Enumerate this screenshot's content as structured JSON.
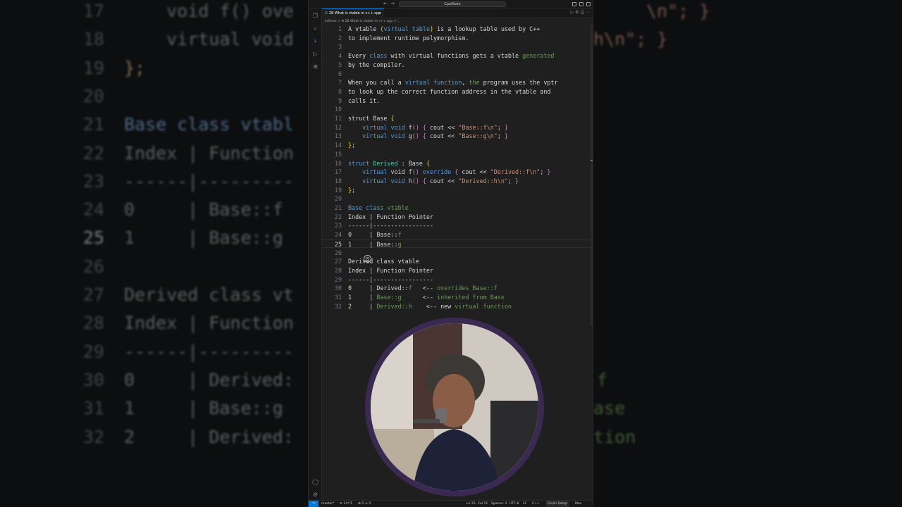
{
  "titlebar": {
    "search": "CppNuts",
    "back": "←",
    "forward": "→"
  },
  "tab": {
    "label": "28 What is vtable in c++.cpp",
    "close": "×"
  },
  "breadcrumb": "InShort  >  ⊕ 28 What is vtable in c++.cpp  >  ...",
  "editor_lines": [
    {
      "n": "1",
      "segs": [
        [
          "A vtable ",
          ""
        ],
        [
          "(",
          "yl"
        ],
        [
          "virtual table",
          "k"
        ],
        [
          ")",
          "yl"
        ],
        [
          " is a lookup table used by C++",
          ""
        ]
      ]
    },
    {
      "n": "2",
      "segs": [
        [
          "to implement runtime polymorphism.",
          ""
        ]
      ]
    },
    {
      "n": "3",
      "segs": []
    },
    {
      "n": "4",
      "segs": [
        [
          "Every ",
          ""
        ],
        [
          "class",
          "k"
        ],
        [
          " with virtual functions gets a vtable ",
          ""
        ],
        [
          "generated",
          "gr"
        ]
      ]
    },
    {
      "n": "5",
      "segs": [
        [
          "by the compiler.",
          ""
        ]
      ]
    },
    {
      "n": "6",
      "segs": []
    },
    {
      "n": "7",
      "segs": [
        [
          "When you call a ",
          ""
        ],
        [
          "virtual",
          "k"
        ],
        [
          " ",
          ""
        ],
        [
          "function",
          "k"
        ],
        [
          ", ",
          ""
        ],
        [
          "the",
          "gr"
        ],
        [
          " program uses the vptr",
          ""
        ]
      ]
    },
    {
      "n": "8",
      "segs": [
        [
          "to look up the correct function address in the vtable and",
          ""
        ]
      ]
    },
    {
      "n": "9",
      "segs": [
        [
          "calls it.",
          ""
        ]
      ]
    },
    {
      "n": "10",
      "segs": []
    },
    {
      "n": "11",
      "segs": [
        [
          "struct Base ",
          ""
        ],
        [
          "{",
          "yl"
        ]
      ]
    },
    {
      "n": "12",
      "segs": [
        [
          "    ",
          ""
        ],
        [
          "virtual void",
          "k"
        ],
        [
          " f",
          ""
        ],
        [
          "()",
          "pu"
        ],
        [
          " ",
          ""
        ],
        [
          "{",
          "pu"
        ],
        [
          " cout << ",
          ""
        ],
        [
          "\"Base::f\\n\"",
          "s"
        ],
        [
          "; ",
          ""
        ],
        [
          "}",
          "pu"
        ]
      ]
    },
    {
      "n": "13",
      "segs": [
        [
          "    ",
          ""
        ],
        [
          "virtual void",
          "k"
        ],
        [
          " g",
          ""
        ],
        [
          "()",
          "pu"
        ],
        [
          " ",
          ""
        ],
        [
          "{",
          "pu"
        ],
        [
          " cout << ",
          ""
        ],
        [
          "\"Base::g\\n\"",
          "s"
        ],
        [
          "; ",
          ""
        ],
        [
          "}",
          "pu"
        ]
      ]
    },
    {
      "n": "14",
      "segs": [
        [
          "}",
          "yl"
        ],
        [
          ";",
          ""
        ]
      ]
    },
    {
      "n": "15",
      "segs": []
    },
    {
      "n": "16",
      "segs": [
        [
          "struct ",
          "k"
        ],
        [
          "Derived",
          "ty"
        ],
        [
          " : Base ",
          ""
        ],
        [
          "{",
          "yl"
        ]
      ]
    },
    {
      "n": "17",
      "segs": [
        [
          "    ",
          ""
        ],
        [
          "virtual",
          "k"
        ],
        [
          " void f",
          ""
        ],
        [
          "()",
          "pu"
        ],
        [
          " override ",
          "k"
        ],
        [
          "{",
          "pu"
        ],
        [
          " cout << ",
          ""
        ],
        [
          "\"Derived::f\\n\"",
          "s"
        ],
        [
          "; ",
          ""
        ],
        [
          "}",
          "pu"
        ]
      ]
    },
    {
      "n": "18",
      "segs": [
        [
          "    ",
          ""
        ],
        [
          "virtual void",
          "k"
        ],
        [
          " h",
          ""
        ],
        [
          "()",
          "pu"
        ],
        [
          " ",
          ""
        ],
        [
          "{",
          "pu"
        ],
        [
          " cout << ",
          ""
        ],
        [
          "\"Derived::h\\n\"",
          "s"
        ],
        [
          "; ",
          ""
        ],
        [
          "}",
          "pu"
        ]
      ]
    },
    {
      "n": "19",
      "segs": [
        [
          "}",
          "yl"
        ],
        [
          ";",
          ""
        ]
      ]
    },
    {
      "n": "20",
      "segs": []
    },
    {
      "n": "21",
      "segs": [
        [
          "Base ",
          "k"
        ],
        [
          "class",
          "k"
        ],
        [
          " vtable",
          "gr"
        ]
      ]
    },
    {
      "n": "22",
      "segs": [
        [
          "Index | Function Pointer",
          ""
        ]
      ]
    },
    {
      "n": "23",
      "segs": [
        [
          "------|-----------------",
          ""
        ]
      ]
    },
    {
      "n": "24",
      "segs": [
        [
          "0     | Base::",
          ""
        ],
        [
          "f",
          "gr"
        ]
      ]
    },
    {
      "n": "25",
      "segs": [
        [
          "1     | Base::",
          ""
        ],
        [
          "g",
          "gr"
        ]
      ],
      "current": true
    },
    {
      "n": "26",
      "segs": []
    },
    {
      "n": "27",
      "segs": [
        [
          "Derived class vtable",
          ""
        ]
      ]
    },
    {
      "n": "28",
      "segs": [
        [
          "Index | Function Pointer",
          ""
        ]
      ]
    },
    {
      "n": "29",
      "segs": [
        [
          "------|-----------------",
          ""
        ]
      ]
    },
    {
      "n": "30",
      "segs": [
        [
          "0     | Derived::",
          ""
        ],
        [
          "f",
          "gr"
        ],
        [
          "   <-- ",
          ""
        ],
        [
          "overrides Base::f",
          "gr"
        ]
      ]
    },
    {
      "n": "31",
      "segs": [
        [
          "1     | ",
          ""
        ],
        [
          "Base::g",
          "gr"
        ],
        [
          "      <-- ",
          ""
        ],
        [
          "inherited from Base",
          "gr"
        ]
      ]
    },
    {
      "n": "32",
      "segs": [
        [
          "2     | ",
          ""
        ],
        [
          "Derived::h",
          "gr"
        ],
        [
          "    <-- new ",
          ""
        ],
        [
          "virtual function",
          "gr"
        ]
      ]
    }
  ],
  "background_left": [
    {
      "n": "17",
      "t": "    void f() ove"
    },
    {
      "n": "18",
      "t": "    virtual void"
    },
    {
      "n": "19",
      "t": "};"
    },
    {
      "n": "20",
      "t": ""
    },
    {
      "n": "21",
      "t": "Base class vtabl"
    },
    {
      "n": "22",
      "t": "Index | Function"
    },
    {
      "n": "23",
      "t": "------|---------"
    },
    {
      "n": "24",
      "t": "0     | Base::f"
    },
    {
      "n": "25",
      "t": "1     | Base::g",
      "current": true
    },
    {
      "n": "26",
      "t": ""
    },
    {
      "n": "27",
      "t": "Derived class vt"
    },
    {
      "n": "28",
      "t": "Index | Function"
    },
    {
      "n": "29",
      "t": "------|---------"
    },
    {
      "n": "30",
      "t": "0     | Derived:"
    },
    {
      "n": "31",
      "t": "1     | Base::g"
    },
    {
      "n": "32",
      "t": "2     | Derived:"
    }
  ],
  "background_right": [
    {
      "t": "\\n\"; }",
      "row": 0
    },
    {
      "t": "h\\n\"; }",
      "row": 1
    },
    {
      "t": "f",
      "row": 13
    },
    {
      "t": "ase",
      "row": 14
    },
    {
      "t": "tion",
      "row": 15
    }
  ],
  "statusbar": {
    "remote": "⌥",
    "branch": "master*",
    "sync": "⟳ 14↑1",
    "problems": "⊗ 0 ⚠ 0",
    "position": "Ln 25, Col 11",
    "spaces": "Spaces: 4",
    "encoding": "UTF-8",
    "eol": "LF",
    "language": "C++",
    "finish_setup": "Finish Setup",
    "platform": "Mac"
  },
  "colors": {
    "accent": "#0078d4",
    "keyword": "#569cd6",
    "string": "#ce9178",
    "type": "#4ec9b0",
    "green": "#6a9955",
    "webcam_ring": "#3a2a52"
  }
}
